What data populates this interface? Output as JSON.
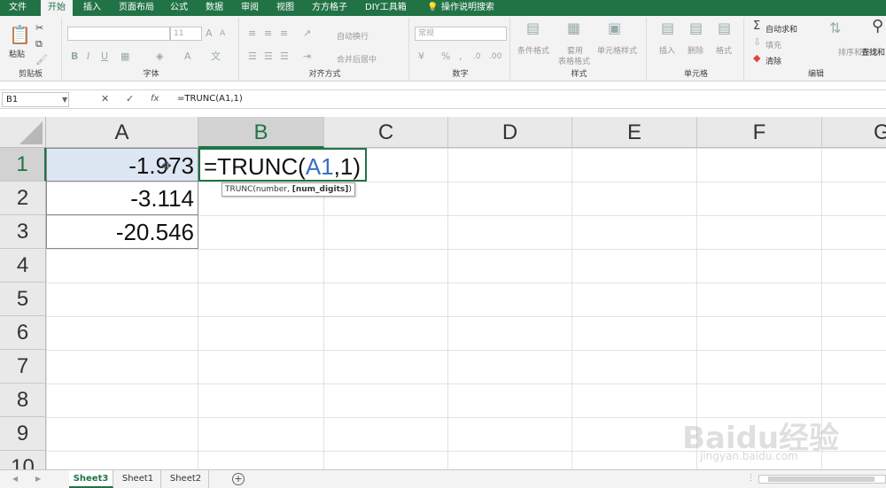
{
  "ribbon_tabs": [
    "文件",
    "开始",
    "插入",
    "页面布局",
    "公式",
    "数据",
    "审阅",
    "视图",
    "方方格子",
    "DIY工具箱",
    "操作说明搜索"
  ],
  "active_tab": "开始",
  "groups": {
    "clipboard": {
      "paste": "粘贴",
      "label": "剪贴板"
    },
    "font": {
      "size": "11",
      "label": "字体",
      "bold": "B",
      "italic": "I",
      "underline": "U"
    },
    "alignment": {
      "wrap": "自动换行",
      "merge": "合并后居中",
      "label": "对齐方式"
    },
    "number": {
      "format": "常规",
      "label": "数字"
    },
    "styles": {
      "conditional": "条件格式",
      "table_a": "套用",
      "table_b": "表格格式",
      "cell_style": "单元格样式",
      "label": "样式"
    },
    "cells": {
      "insert": "插入",
      "delete": "删除",
      "format": "格式",
      "label": "单元格"
    },
    "editing": {
      "autosum": "自动求和",
      "fill": "填充",
      "clear": "清除",
      "sort": "排序和筛选",
      "find": "查找和",
      "label": "编辑"
    }
  },
  "formula_bar": {
    "name_box": "B1",
    "formula": "=TRUNC(A1,1)",
    "cancel": "✕",
    "enter": "✓",
    "fx": "fx"
  },
  "columns": [
    "A",
    "B",
    "C",
    "D",
    "E",
    "F",
    "G"
  ],
  "rows": [
    "1",
    "2",
    "3",
    "4",
    "5",
    "6",
    "7",
    "8",
    "9",
    "10"
  ],
  "cells": {
    "A1": "-1.973",
    "A2": "-3.114",
    "A3": "-20.546",
    "B1_prefix": "=TRUNC(",
    "B1_ref": "A1",
    "B1_suffix": ",1)"
  },
  "tooltip": {
    "text": "TRUNC(number, ",
    "bold": "[num_digits]",
    "close": ")"
  },
  "sheets": [
    "Sheet3",
    "Sheet1",
    "Sheet2"
  ],
  "active_sheet": "Sheet3",
  "add_sheet": "+",
  "watermark": "Baidu经验",
  "watermark_url": "jingyan.baidu.com",
  "colors": {
    "excel_green": "#217346",
    "ref_blue": "#3a6fc4"
  }
}
